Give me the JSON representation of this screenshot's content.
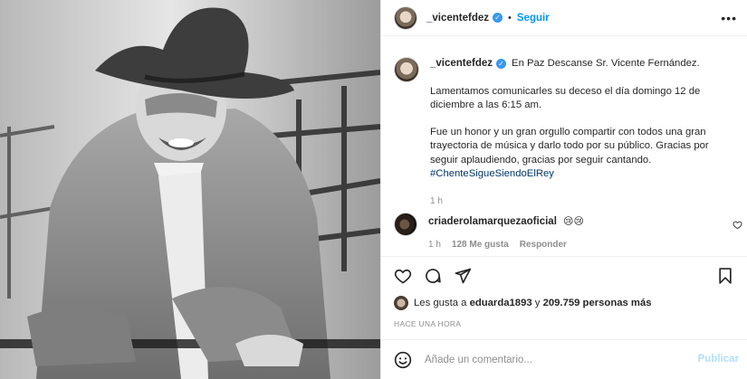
{
  "post": {
    "username": "_vicentefdez",
    "follow_label": "Seguir",
    "more_label": "•••",
    "verified_mark": "✓",
    "separator": "•"
  },
  "caption": {
    "username": "_vicentefdez",
    "line1": "En Paz Descanse Sr. Vicente Fernández.",
    "para1": "Lamentamos comunicarles su deceso el día domingo 12 de diciembre a las 6:15 am.",
    "para2": "Fue un honor y un gran orgullo compartir con todos una gran trayectoria de música y darlo todo por su público. Gracias por seguir aplaudiendo, gracias por seguir cantando.",
    "hashtag": "#ChenteSigueSiendoElRey",
    "time": "1 h"
  },
  "comment": {
    "username": "criaderolamarquezaoficial",
    "emojis": "😢😢",
    "time": "1 h",
    "likes": "128 Me gusta",
    "reply_label": "Responder",
    "heart_icon": "heart-outline"
  },
  "actions": {
    "like_icon": "heart-outline",
    "comment_icon": "speech-bubble",
    "share_icon": "paper-plane",
    "save_icon": "bookmark"
  },
  "likes": {
    "prefix": "Les gusta a ",
    "user": "eduarda1893",
    "middle": " y ",
    "count": "209.759 personas más"
  },
  "timestamp": "HACE UNA HORA",
  "comment_box": {
    "placeholder": "Añade un comentario...",
    "publish_label": "Publicar",
    "emoji_icon": "smiley-face"
  },
  "colors": {
    "link_blue": "#0095f6",
    "hashtag": "#00376b",
    "muted": "#8e8e8e",
    "publish_disabled": "#b2dffc",
    "verified": "#3897f0"
  }
}
